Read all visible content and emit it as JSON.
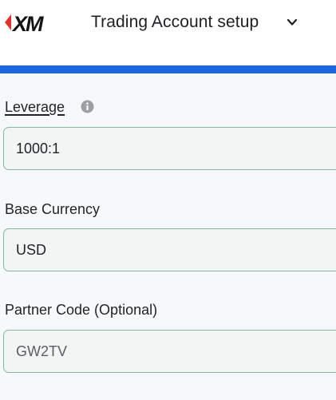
{
  "header": {
    "logo_text": "XM",
    "title": "Trading Account setup",
    "dropdown_icon": "chevron-down-icon",
    "accent_red": "#e4322b",
    "accent_blue": "#1a66e0"
  },
  "form": {
    "leverage": {
      "label": "Leverage",
      "info_icon": "info-icon",
      "value": "1000:1"
    },
    "base_currency": {
      "label": "Base Currency",
      "value": "USD"
    },
    "partner_code": {
      "label": "Partner Code (Optional)",
      "value": "GW2TV"
    }
  },
  "colors": {
    "field_border": "#7dbb9b",
    "field_background": "#f1f6f5"
  }
}
